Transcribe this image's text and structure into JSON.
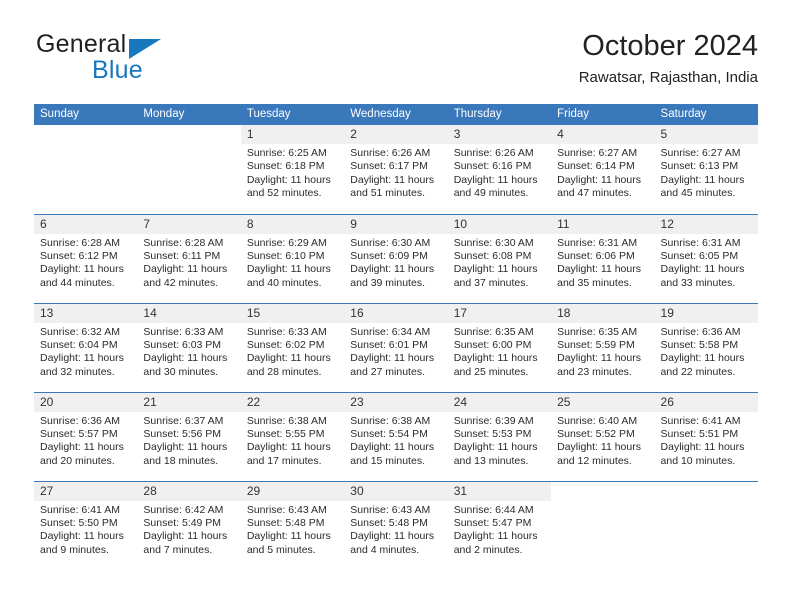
{
  "brand": {
    "word_one": "General",
    "word_two": "Blue",
    "triangle_icon": "blue-triangle-logo-icon",
    "colors": {
      "dark": "#231f20",
      "blue": "#1878be"
    }
  },
  "header": {
    "title": "October 2024",
    "location": "Rawatsar, Rajasthan, India"
  },
  "theme": {
    "header_blue": "#3a78bc",
    "daynum_band": "#f0f0f0",
    "text": "#2b2b2b"
  },
  "weekday_headers": [
    "Sunday",
    "Monday",
    "Tuesday",
    "Wednesday",
    "Thursday",
    "Friday",
    "Saturday"
  ],
  "labels": {
    "sunrise_prefix": "Sunrise:",
    "sunset_prefix": "Sunset:",
    "daylight_prefix": "Daylight:"
  },
  "weeks": [
    [
      {
        "day": "",
        "sunrise": "",
        "sunset": "",
        "daylight_line1": "",
        "daylight_line2": "",
        "blank": true
      },
      {
        "day": "",
        "sunrise": "",
        "sunset": "",
        "daylight_line1": "",
        "daylight_line2": "",
        "blank": true
      },
      {
        "day": "1",
        "sunrise": "Sunrise: 6:25 AM",
        "sunset": "Sunset: 6:18 PM",
        "daylight_line1": "Daylight: 11 hours",
        "daylight_line2": "and 52 minutes."
      },
      {
        "day": "2",
        "sunrise": "Sunrise: 6:26 AM",
        "sunset": "Sunset: 6:17 PM",
        "daylight_line1": "Daylight: 11 hours",
        "daylight_line2": "and 51 minutes."
      },
      {
        "day": "3",
        "sunrise": "Sunrise: 6:26 AM",
        "sunset": "Sunset: 6:16 PM",
        "daylight_line1": "Daylight: 11 hours",
        "daylight_line2": "and 49 minutes."
      },
      {
        "day": "4",
        "sunrise": "Sunrise: 6:27 AM",
        "sunset": "Sunset: 6:14 PM",
        "daylight_line1": "Daylight: 11 hours",
        "daylight_line2": "and 47 minutes."
      },
      {
        "day": "5",
        "sunrise": "Sunrise: 6:27 AM",
        "sunset": "Sunset: 6:13 PM",
        "daylight_line1": "Daylight: 11 hours",
        "daylight_line2": "and 45 minutes."
      }
    ],
    [
      {
        "day": "6",
        "sunrise": "Sunrise: 6:28 AM",
        "sunset": "Sunset: 6:12 PM",
        "daylight_line1": "Daylight: 11 hours",
        "daylight_line2": "and 44 minutes."
      },
      {
        "day": "7",
        "sunrise": "Sunrise: 6:28 AM",
        "sunset": "Sunset: 6:11 PM",
        "daylight_line1": "Daylight: 11 hours",
        "daylight_line2": "and 42 minutes."
      },
      {
        "day": "8",
        "sunrise": "Sunrise: 6:29 AM",
        "sunset": "Sunset: 6:10 PM",
        "daylight_line1": "Daylight: 11 hours",
        "daylight_line2": "and 40 minutes."
      },
      {
        "day": "9",
        "sunrise": "Sunrise: 6:30 AM",
        "sunset": "Sunset: 6:09 PM",
        "daylight_line1": "Daylight: 11 hours",
        "daylight_line2": "and 39 minutes."
      },
      {
        "day": "10",
        "sunrise": "Sunrise: 6:30 AM",
        "sunset": "Sunset: 6:08 PM",
        "daylight_line1": "Daylight: 11 hours",
        "daylight_line2": "and 37 minutes."
      },
      {
        "day": "11",
        "sunrise": "Sunrise: 6:31 AM",
        "sunset": "Sunset: 6:06 PM",
        "daylight_line1": "Daylight: 11 hours",
        "daylight_line2": "and 35 minutes."
      },
      {
        "day": "12",
        "sunrise": "Sunrise: 6:31 AM",
        "sunset": "Sunset: 6:05 PM",
        "daylight_line1": "Daylight: 11 hours",
        "daylight_line2": "and 33 minutes."
      }
    ],
    [
      {
        "day": "13",
        "sunrise": "Sunrise: 6:32 AM",
        "sunset": "Sunset: 6:04 PM",
        "daylight_line1": "Daylight: 11 hours",
        "daylight_line2": "and 32 minutes."
      },
      {
        "day": "14",
        "sunrise": "Sunrise: 6:33 AM",
        "sunset": "Sunset: 6:03 PM",
        "daylight_line1": "Daylight: 11 hours",
        "daylight_line2": "and 30 minutes."
      },
      {
        "day": "15",
        "sunrise": "Sunrise: 6:33 AM",
        "sunset": "Sunset: 6:02 PM",
        "daylight_line1": "Daylight: 11 hours",
        "daylight_line2": "and 28 minutes."
      },
      {
        "day": "16",
        "sunrise": "Sunrise: 6:34 AM",
        "sunset": "Sunset: 6:01 PM",
        "daylight_line1": "Daylight: 11 hours",
        "daylight_line2": "and 27 minutes."
      },
      {
        "day": "17",
        "sunrise": "Sunrise: 6:35 AM",
        "sunset": "Sunset: 6:00 PM",
        "daylight_line1": "Daylight: 11 hours",
        "daylight_line2": "and 25 minutes."
      },
      {
        "day": "18",
        "sunrise": "Sunrise: 6:35 AM",
        "sunset": "Sunset: 5:59 PM",
        "daylight_line1": "Daylight: 11 hours",
        "daylight_line2": "and 23 minutes."
      },
      {
        "day": "19",
        "sunrise": "Sunrise: 6:36 AM",
        "sunset": "Sunset: 5:58 PM",
        "daylight_line1": "Daylight: 11 hours",
        "daylight_line2": "and 22 minutes."
      }
    ],
    [
      {
        "day": "20",
        "sunrise": "Sunrise: 6:36 AM",
        "sunset": "Sunset: 5:57 PM",
        "daylight_line1": "Daylight: 11 hours",
        "daylight_line2": "and 20 minutes."
      },
      {
        "day": "21",
        "sunrise": "Sunrise: 6:37 AM",
        "sunset": "Sunset: 5:56 PM",
        "daylight_line1": "Daylight: 11 hours",
        "daylight_line2": "and 18 minutes."
      },
      {
        "day": "22",
        "sunrise": "Sunrise: 6:38 AM",
        "sunset": "Sunset: 5:55 PM",
        "daylight_line1": "Daylight: 11 hours",
        "daylight_line2": "and 17 minutes."
      },
      {
        "day": "23",
        "sunrise": "Sunrise: 6:38 AM",
        "sunset": "Sunset: 5:54 PM",
        "daylight_line1": "Daylight: 11 hours",
        "daylight_line2": "and 15 minutes."
      },
      {
        "day": "24",
        "sunrise": "Sunrise: 6:39 AM",
        "sunset": "Sunset: 5:53 PM",
        "daylight_line1": "Daylight: 11 hours",
        "daylight_line2": "and 13 minutes."
      },
      {
        "day": "25",
        "sunrise": "Sunrise: 6:40 AM",
        "sunset": "Sunset: 5:52 PM",
        "daylight_line1": "Daylight: 11 hours",
        "daylight_line2": "and 12 minutes."
      },
      {
        "day": "26",
        "sunrise": "Sunrise: 6:41 AM",
        "sunset": "Sunset: 5:51 PM",
        "daylight_line1": "Daylight: 11 hours",
        "daylight_line2": "and 10 minutes."
      }
    ],
    [
      {
        "day": "27",
        "sunrise": "Sunrise: 6:41 AM",
        "sunset": "Sunset: 5:50 PM",
        "daylight_line1": "Daylight: 11 hours",
        "daylight_line2": "and 9 minutes."
      },
      {
        "day": "28",
        "sunrise": "Sunrise: 6:42 AM",
        "sunset": "Sunset: 5:49 PM",
        "daylight_line1": "Daylight: 11 hours",
        "daylight_line2": "and 7 minutes."
      },
      {
        "day": "29",
        "sunrise": "Sunrise: 6:43 AM",
        "sunset": "Sunset: 5:48 PM",
        "daylight_line1": "Daylight: 11 hours",
        "daylight_line2": "and 5 minutes."
      },
      {
        "day": "30",
        "sunrise": "Sunrise: 6:43 AM",
        "sunset": "Sunset: 5:48 PM",
        "daylight_line1": "Daylight: 11 hours",
        "daylight_line2": "and 4 minutes."
      },
      {
        "day": "31",
        "sunrise": "Sunrise: 6:44 AM",
        "sunset": "Sunset: 5:47 PM",
        "daylight_line1": "Daylight: 11 hours",
        "daylight_line2": "and 2 minutes."
      },
      {
        "day": "",
        "sunrise": "",
        "sunset": "",
        "daylight_line1": "",
        "daylight_line2": "",
        "blank": true
      },
      {
        "day": "",
        "sunrise": "",
        "sunset": "",
        "daylight_line1": "",
        "daylight_line2": "",
        "blank": true
      }
    ]
  ]
}
